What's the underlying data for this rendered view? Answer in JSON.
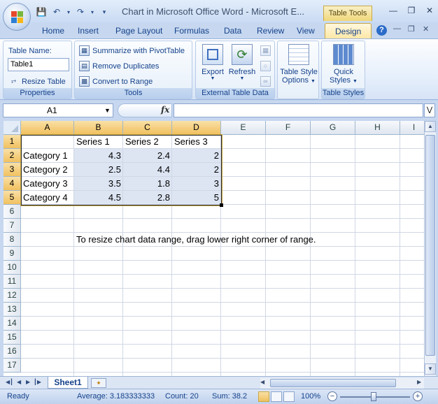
{
  "window": {
    "title": "Chart in Microsoft Office Word - Microsoft E...",
    "context_tab": "Table Tools"
  },
  "tabs": [
    "Home",
    "Insert",
    "Page Layout",
    "Formulas",
    "Data",
    "Review",
    "View",
    "Design"
  ],
  "active_tab": "Design",
  "ribbon": {
    "properties": {
      "table_name_label": "Table Name:",
      "table_name_value": "Table1",
      "resize_label": "Resize Table",
      "group_label": "Properties"
    },
    "tools": {
      "summarize": "Summarize with PivotTable",
      "remove_duplicates": "Remove Duplicates",
      "convert": "Convert to Range",
      "group_label": "Tools"
    },
    "external": {
      "export": "Export",
      "refresh": "Refresh",
      "group_label": "External Table Data"
    },
    "style_options": {
      "label_line1": "Table Style",
      "label_line2": "Options"
    },
    "styles": {
      "label_line1": "Quick",
      "label_line2": "Styles",
      "group_label": "Table Styles"
    }
  },
  "formula_bar": {
    "name_box": "A1",
    "fx": "fx",
    "formula": ""
  },
  "sheet": {
    "columns": [
      "A",
      "B",
      "C",
      "D",
      "E",
      "F",
      "G",
      "H",
      "I"
    ],
    "rows": [
      "1",
      "2",
      "3",
      "4",
      "5",
      "6",
      "7",
      "8",
      "9",
      "10",
      "11",
      "12",
      "13",
      "14",
      "15",
      "16",
      "17"
    ],
    "headers": [
      "Series 1",
      "Series 2",
      "Series 3"
    ],
    "data": [
      {
        "category": "Category 1",
        "s1": "4.3",
        "s2": "2.4",
        "s3": "2"
      },
      {
        "category": "Category 2",
        "s1": "2.5",
        "s2": "4.4",
        "s3": "2"
      },
      {
        "category": "Category 3",
        "s1": "3.5",
        "s2": "1.8",
        "s3": "3"
      },
      {
        "category": "Category 4",
        "s1": "4.5",
        "s2": "2.8",
        "s3": "5"
      }
    ],
    "note": "To resize chart data range, drag lower right corner of range."
  },
  "sheet_tabs": {
    "active": "Sheet1"
  },
  "status": {
    "ready": "Ready",
    "average": "Average: 3.183333333",
    "count": "Count: 20",
    "sum": "Sum: 38.2",
    "zoom": "100%"
  },
  "colors": {
    "ribbon_blue": "#c6d7ef",
    "accent_gold": "#f1c15f",
    "table_fill": "#dde5f3"
  }
}
